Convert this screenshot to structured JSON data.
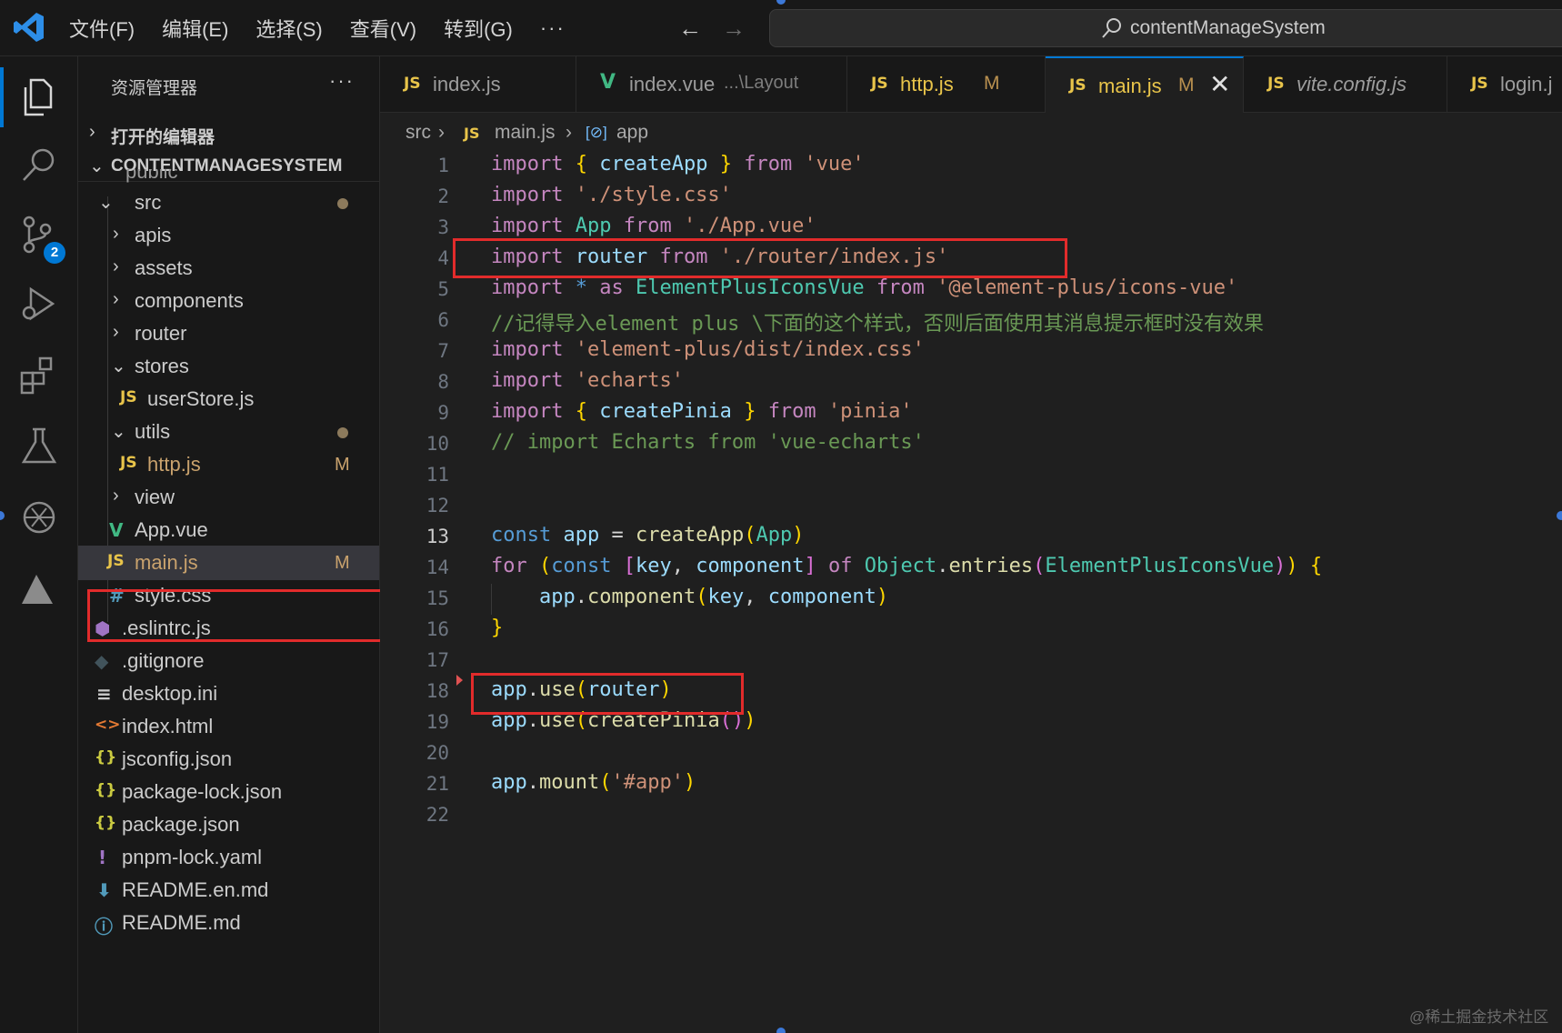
{
  "menubar": {
    "items": [
      "文件(F)",
      "编辑(E)",
      "选择(S)",
      "查看(V)",
      "转到(G)"
    ],
    "more": "···",
    "back": "←",
    "forward": "→",
    "search_text": "contentManageSystem"
  },
  "activity_bar": {
    "items": [
      "explorer-icon",
      "search-icon",
      "source-control-icon",
      "run-debug-icon",
      "extensions-icon",
      "testing-icon",
      "chatgpt-icon",
      "remote-icon"
    ],
    "scm_badge": "2"
  },
  "explorer": {
    "title": "资源管理器",
    "more": "···",
    "open_editors_label": "打开的编辑器",
    "project_label": "CONTENTMANAGESYSTEM",
    "partial_top": "public",
    "tree": [
      {
        "name": "src",
        "type": "folder-open",
        "status": "dot"
      },
      {
        "name": "apis",
        "type": "folder"
      },
      {
        "name": "assets",
        "type": "folder"
      },
      {
        "name": "components",
        "type": "folder"
      },
      {
        "name": "router",
        "type": "folder"
      },
      {
        "name": "stores",
        "type": "folder-open"
      },
      {
        "name": "userStore.js",
        "type": "js"
      },
      {
        "name": "utils",
        "type": "folder-open",
        "status": "dot"
      },
      {
        "name": "http.js",
        "type": "js",
        "status": "M"
      },
      {
        "name": "view",
        "type": "folder"
      },
      {
        "name": "App.vue",
        "type": "vue"
      },
      {
        "name": "main.js",
        "type": "js",
        "status": "M"
      },
      {
        "name": "style.css",
        "type": "css"
      },
      {
        "name": ".eslintrc.js",
        "type": "eslint"
      },
      {
        "name": ".gitignore",
        "type": "git"
      },
      {
        "name": "desktop.ini",
        "type": "ini"
      },
      {
        "name": "index.html",
        "type": "html"
      },
      {
        "name": "jsconfig.json",
        "type": "json"
      },
      {
        "name": "package-lock.json",
        "type": "json"
      },
      {
        "name": "package.json",
        "type": "json"
      },
      {
        "name": "pnpm-lock.yaml",
        "type": "yaml"
      },
      {
        "name": "README.en.md",
        "type": "md"
      },
      {
        "name": "README.md",
        "type": "info"
      }
    ]
  },
  "tabs": [
    {
      "icon": "JS",
      "name": "index.js"
    },
    {
      "icon": "V",
      "name": "index.vue",
      "detail": "...\\Layout"
    },
    {
      "icon": "JS",
      "name": "http.js",
      "status": "M"
    },
    {
      "icon": "JS",
      "name": "main.js",
      "status": "M",
      "active": true,
      "close": "✕"
    },
    {
      "icon": "JS",
      "name": "vite.config.js"
    },
    {
      "icon": "JS",
      "name": "login.j"
    }
  ],
  "breadcrumb": {
    "folder": "src",
    "file_icon": "JS",
    "file": "main.js",
    "symbol_icon": "[⊘]",
    "symbol": "app",
    "separator": "›"
  },
  "editor": {
    "line_numbers": [
      "1",
      "2",
      "3",
      "4",
      "5",
      "6",
      "7",
      "8",
      "9",
      "10",
      "11",
      "12",
      "13",
      "14",
      "15",
      "16",
      "17",
      "18",
      "19",
      "20",
      "21",
      "22"
    ],
    "current_line": "13",
    "lines": [
      "import { createApp } from 'vue'",
      "import './style.css'",
      "import App from './App.vue'",
      "import router from './router/index.js'",
      "import * as ElementPlusIconsVue from '@element-plus/icons-vue'",
      "//记得导入element plus \\下面的这个样式，否则后面使用其消息提示框时没有效果",
      "import 'element-plus/dist/index.css'",
      "import 'echarts'",
      "import { createPinia } from 'pinia'",
      "// import Echarts from 'vue-echarts'",
      "",
      "",
      "const app = createApp(App)",
      "for (const [key, component] of Object.entries(ElementPlusIconsVue)) {",
      "    app.component(key, component)",
      "}",
      "",
      "app.use(router)",
      "app.use(createPinia())",
      "",
      "app.mount('#app')",
      ""
    ]
  },
  "watermark": "@稀土掘金技术社区",
  "colors": {
    "accent": "#0078d4",
    "highlight_box": "#e22b2b",
    "modified": "#b9904f",
    "js_icon": "#e8c44a",
    "vue_icon": "#41b883"
  }
}
